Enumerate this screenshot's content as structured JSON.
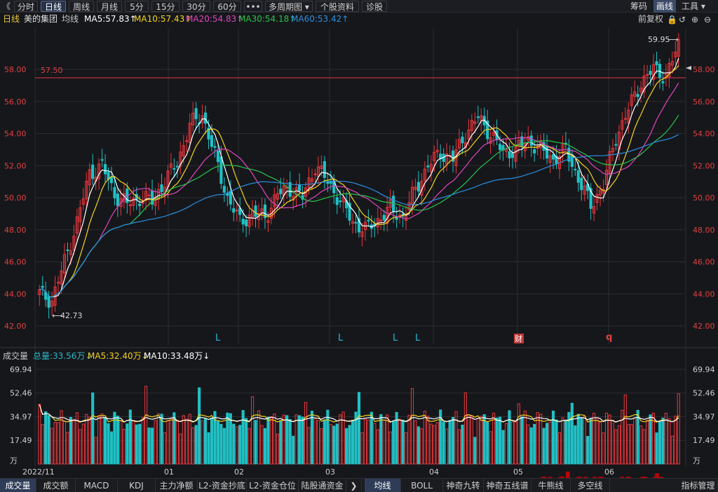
{
  "toolbar": {
    "back": "《",
    "tabs": [
      "分时",
      "日线",
      "周线",
      "月线",
      "5分",
      "15分",
      "30分",
      "60分",
      "•••",
      "多周期图 ▾",
      "个股资料",
      "诊股"
    ],
    "active_tab": "日线",
    "right": [
      "筹码",
      "画线",
      "工具 ▾"
    ],
    "right_active": "画线"
  },
  "info": {
    "period": "日线",
    "stock": "美的集团",
    "avg_label": "均线",
    "ma5": "MA5:57.83↑",
    "ma10": "MA10:57.43↑",
    "ma20": "MA20:54.83↑",
    "ma30": "MA30:54.18↑",
    "ma60": "MA60:53.42↑",
    "fuquan": "前复权",
    "colors": {
      "ma5": "#ffffff",
      "ma10": "#f5d31f",
      "ma20": "#e046c0",
      "ma30": "#28c44b",
      "ma60": "#2b8fe0"
    }
  },
  "price_axis": [
    "58.00",
    "56.00",
    "54.00",
    "52.00",
    "50.00",
    "48.00",
    "46.00",
    "44.00",
    "42.00"
  ],
  "annotations": {
    "high": "59.95",
    "low": "42.73",
    "hline": "57.50",
    "markers": [
      "L",
      "L",
      "L",
      "L"
    ],
    "cai": "财",
    "q": "q"
  },
  "volume": {
    "title": "成交量",
    "total": "总量:33.56万↓",
    "ma5": "MA5:32.40万↓",
    "ma10": "MA10:33.48万↓",
    "axis": [
      "69.94",
      "52.46",
      "34.97",
      "17.49",
      "万"
    ]
  },
  "x_axis": [
    "2022/11",
    "01",
    "02",
    "03",
    "04",
    "05",
    "06"
  ],
  "bottom_tabs": [
    "成交量",
    "成交额",
    "MACD",
    "KDJ",
    "主力净额",
    "L2-资金抄底",
    "L2-资金仓位",
    "陆股通资金",
    "均线",
    "BOLL",
    "神奇九转",
    "神奇五线谱",
    "牛熊线",
    "多空线",
    "指标管理"
  ],
  "watermark": "gdgp.net",
  "chart_data": {
    "type": "candlestick",
    "price_range": [
      42,
      60
    ],
    "volume_range": [
      0,
      70
    ],
    "ma_series_names": [
      "MA5",
      "MA10",
      "MA20",
      "MA30",
      "MA60"
    ]
  }
}
